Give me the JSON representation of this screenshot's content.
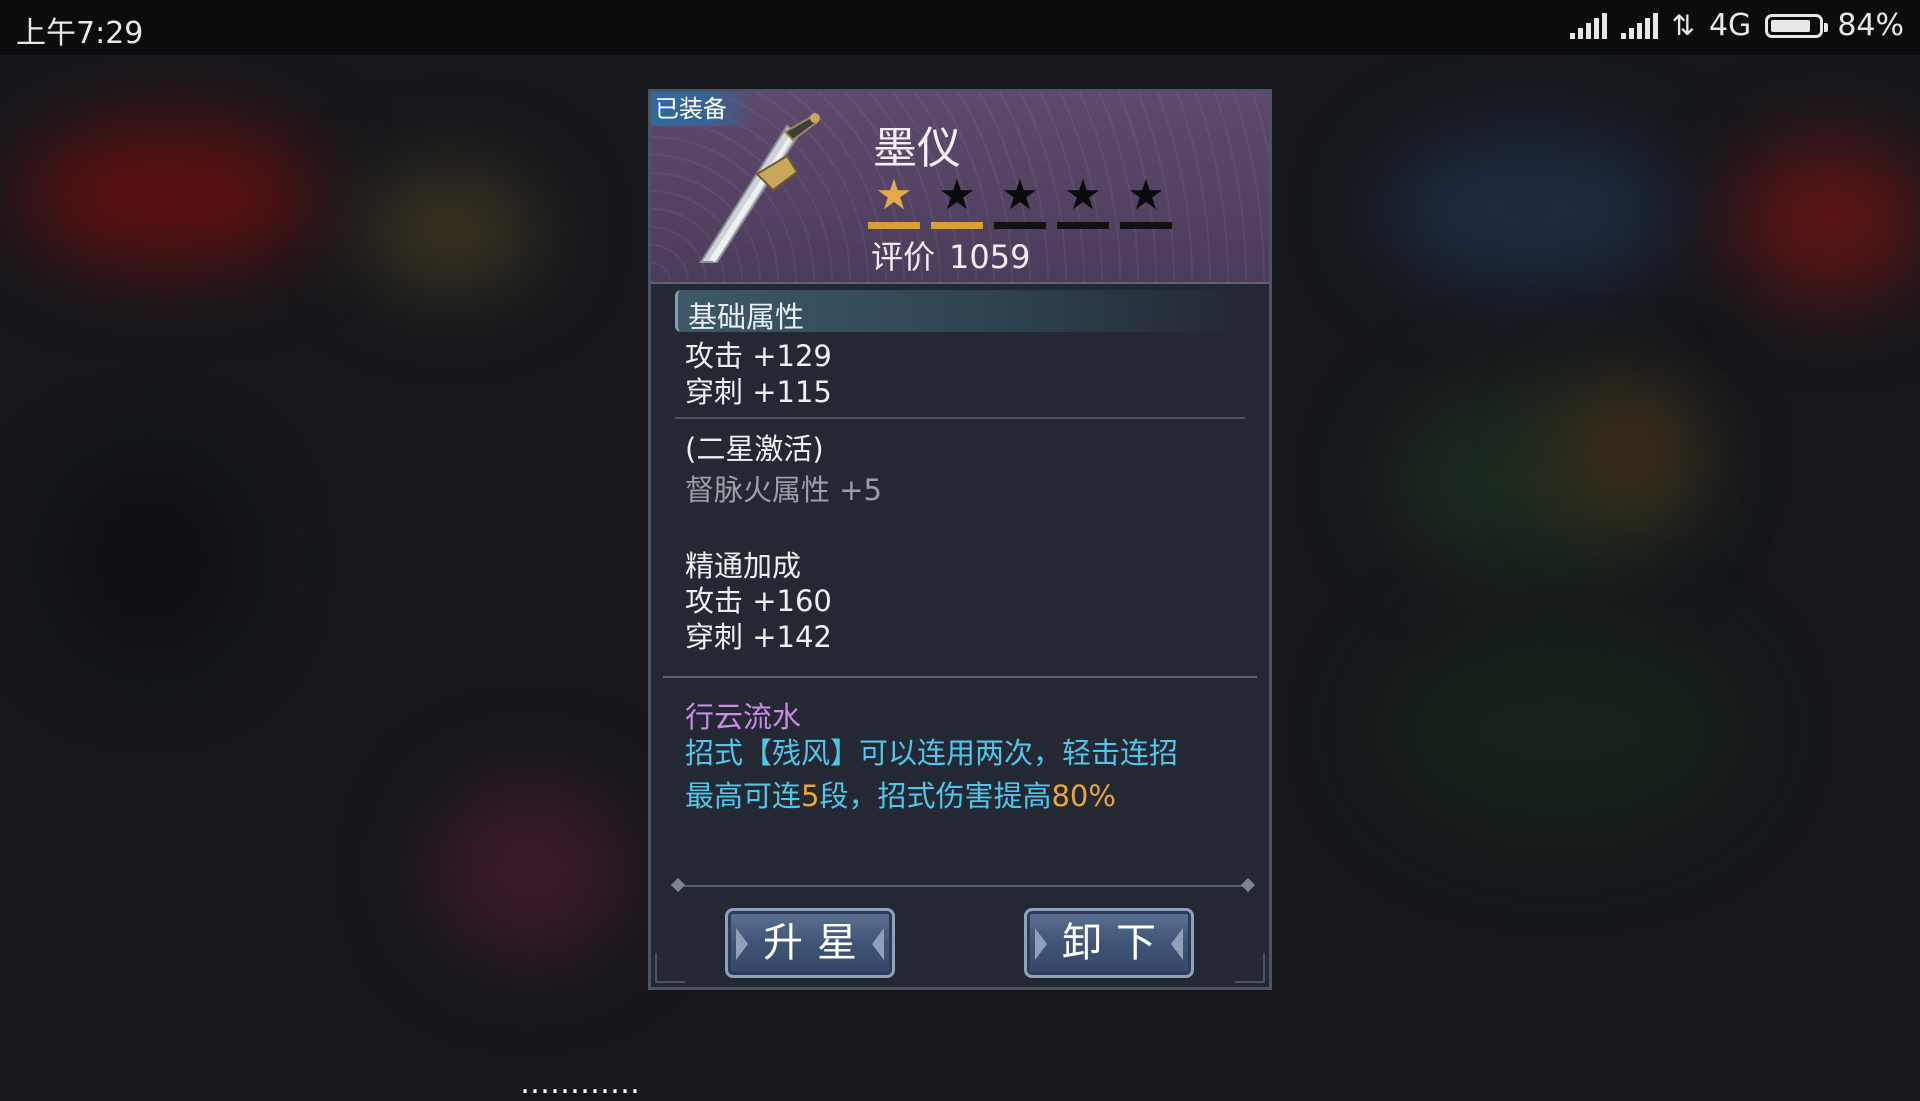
{
  "status_bar": {
    "time": "上午7:29",
    "network": "4G",
    "battery_text": "84%",
    "battery_level": 0.84
  },
  "item": {
    "equipped_label": "已装备",
    "name": "墨仪",
    "icon": "sword-icon",
    "stars_total": 5,
    "stars_lit": 1,
    "star_bars_lit": 2,
    "rating_label": "评价",
    "rating_value": "1059"
  },
  "base_attributes": {
    "title": "基础属性",
    "lines": [
      "攻击 +129",
      "穿刺 +115"
    ]
  },
  "star_activation": {
    "title": "(二星激活)",
    "line": "督脉火属性 +5"
  },
  "mastery": {
    "title": "精通加成",
    "lines": [
      "攻击 +160",
      "穿刺 +142"
    ]
  },
  "skill": {
    "name": "行云流水",
    "desc_line1": "招式【残风】可以连用两次，轻击连招",
    "desc_line2_a": "最高可连",
    "desc_line2_num": "5",
    "desc_line2_b": "段，招式伤害提高",
    "desc_line2_pct": "80%"
  },
  "buttons": {
    "upgrade_star": "升星",
    "unequip": "卸下"
  },
  "ticker": {
    "part1": "……",
    "part2": "……"
  },
  "colors": {
    "star_on": "#e3a94a",
    "skill_name": "#c98be6",
    "skill_desc": "#4fc6ea",
    "highlight": "#e9a63b"
  }
}
